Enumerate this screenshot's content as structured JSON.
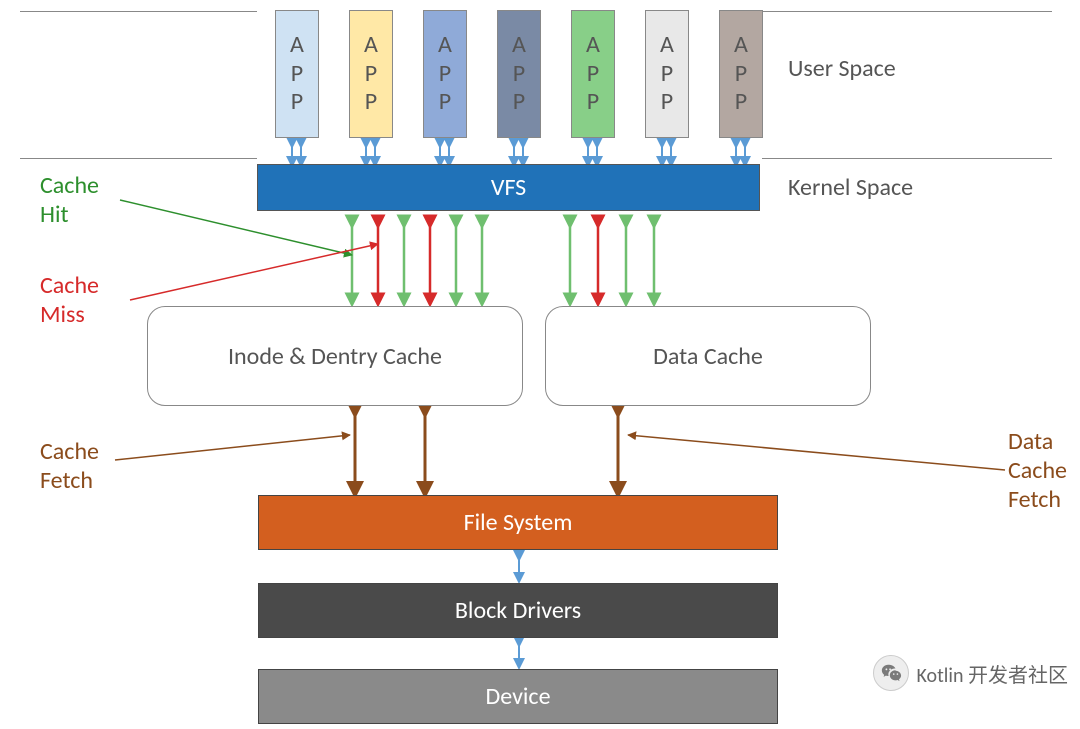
{
  "apps": {
    "label": "APP"
  },
  "app_colors": [
    "#cfe2f3",
    "#ffe8a6",
    "#8faad8",
    "#7a8aa5",
    "#88cf88",
    "#e8e8e8",
    "#b3a7a1"
  ],
  "labels": {
    "user_space": "User Space",
    "kernel_space": "Kernel Space",
    "cache_hit": "Cache\nHit",
    "cache_miss": "Cache\nMiss",
    "cache_fetch": "Cache\nFetch",
    "data_cache_fetch": "Data\nCache\nFetch"
  },
  "vfs": "VFS",
  "inode_cache": "Inode & Dentry Cache",
  "data_cache": "Data Cache",
  "file_system": "File System",
  "block_drivers": "Block Drivers",
  "device": "Device",
  "watermark": "Kotlin 开发者社区"
}
